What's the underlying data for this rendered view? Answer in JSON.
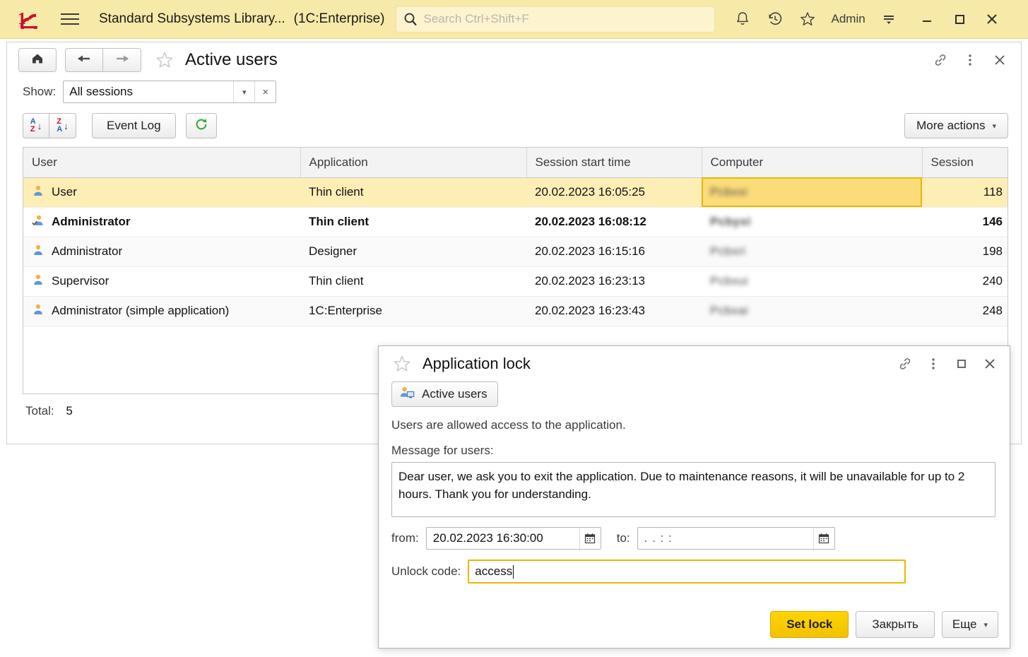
{
  "titlebar": {
    "logo": "1c-logo-icon",
    "menu_icon": "hamburger-menu-icon",
    "app_title": "Standard Subsystems Library...",
    "app_kind": "(1C:Enterprise)",
    "search": {
      "placeholder": "Search Ctrl+Shift+F",
      "value": ""
    },
    "notifications_icon": "bell-icon",
    "history_icon": "history-clock-icon",
    "favorites_icon": "star-icon",
    "user": "Admin",
    "user_menu_icon": "filter-lines-icon",
    "minimize": "minimize-icon",
    "maximize": "maximize-icon",
    "close": "close-icon",
    "bg_color": "#f7e9a8"
  },
  "form": {
    "home_icon": "home-icon",
    "back_icon": "arrow-left-icon",
    "forward_icon": "arrow-right-icon",
    "favorite_icon": "star-outline-icon",
    "title": "Active users",
    "link_icon": "link-icon",
    "kebab_icon": "more-vertical-icon",
    "close_icon": "close-icon",
    "filter": {
      "label": "Show:",
      "value": "All sessions",
      "dropdown_icon": "chevron-down-icon",
      "clear_icon": "clear-x-icon"
    },
    "commands": {
      "sort_asc": "sort-ascending-icon",
      "sort_desc": "sort-descending-icon",
      "sort_asc_letters": [
        "A",
        "Z"
      ],
      "sort_desc_letters": [
        "Z",
        "A"
      ],
      "event_log": "Event Log",
      "refresh_icon": "refresh-icon",
      "more_actions": "More actions",
      "more_actions_caret": "chevron-down-icon"
    },
    "table": {
      "columns": [
        "User",
        "Application",
        "Session start time",
        "Computer",
        "Session"
      ],
      "rows": [
        {
          "user": "User",
          "application": "Thin client",
          "start": "20.02.2023 16:05:25",
          "computer": "Pcbxxi",
          "session": "118",
          "selected": true,
          "bold": false,
          "cell_cursor": "computer"
        },
        {
          "user": "Administrator",
          "application": "Thin client",
          "start": "20.02.2023 16:08:12",
          "computer": "Pcbyxi",
          "session": "146",
          "selected": false,
          "bold": true,
          "cell_cursor": ""
        },
        {
          "user": "Administrator",
          "application": "Designer",
          "start": "20.02.2023 16:15:16",
          "computer": "Pcbxri",
          "session": "198",
          "selected": false,
          "bold": false,
          "cell_cursor": ""
        },
        {
          "user": "Supervisor",
          "application": "Thin client",
          "start": "20.02.2023 16:23:13",
          "computer": "Pcbxui",
          "session": "240",
          "selected": false,
          "bold": false,
          "cell_cursor": ""
        },
        {
          "user": "Administrator (simple application)",
          "application": "1C:Enterprise",
          "start": "20.02.2023 16:23:43",
          "computer": "Pcbxai",
          "session": "248",
          "selected": false,
          "bold": false,
          "cell_cursor": ""
        }
      ],
      "user_icon": "user-icon",
      "current_user_icon": "current-user-icon"
    },
    "total_label": "Total:",
    "total_value": "5"
  },
  "dialog": {
    "favorite_icon": "star-outline-icon",
    "title": "Application lock",
    "link_icon": "link-icon",
    "kebab_icon": "more-vertical-icon",
    "maximize_icon": "maximize-icon",
    "close_icon": "close-icon",
    "active_users_button": "Active users",
    "active_users_icon": "user-computer-icon",
    "status_text": "Users are allowed access to the application.",
    "message_label": "Message for users:",
    "message_value": "Dear user, we ask you to exit the application. Due to maintenance reasons, it will be unavailable for up to 2 hours. Thank you for understanding.",
    "from_label": "from:",
    "from_value": "20.02.2023 16:30:00",
    "to_label": "to:",
    "to_value": ".  .          :  :",
    "calendar_icon": "calendar-icon",
    "unlock_label": "Unlock code:",
    "unlock_value": "access",
    "set_lock_button": "Set lock",
    "close_button": "Закрыть",
    "more_button": "Еще",
    "more_caret": "chevron-down-icon",
    "accent_color": "#ffd400",
    "focus_color": "#e8b700"
  }
}
